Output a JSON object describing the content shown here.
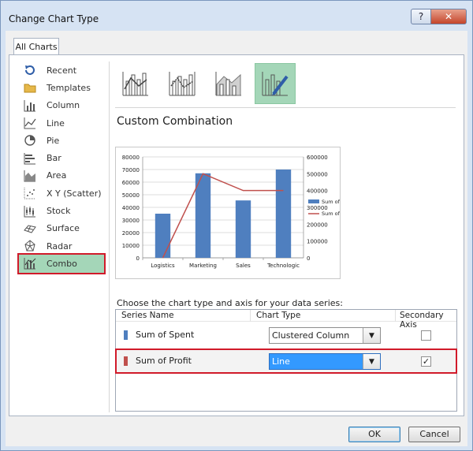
{
  "window": {
    "title": "Change Chart Type",
    "help": "?",
    "close": "✕"
  },
  "tab": "All Charts",
  "categories": [
    {
      "label": "Recent",
      "icon": "recent-icon"
    },
    {
      "label": "Templates",
      "icon": "templates-icon"
    },
    {
      "label": "Column",
      "icon": "column-chart-icon"
    },
    {
      "label": "Line",
      "icon": "line-chart-icon"
    },
    {
      "label": "Pie",
      "icon": "pie-chart-icon"
    },
    {
      "label": "Bar",
      "icon": "bar-chart-icon"
    },
    {
      "label": "Area",
      "icon": "area-chart-icon"
    },
    {
      "label": "X Y (Scatter)",
      "icon": "scatter-chart-icon"
    },
    {
      "label": "Stock",
      "icon": "stock-chart-icon"
    },
    {
      "label": "Surface",
      "icon": "surface-chart-icon"
    },
    {
      "label": "Radar",
      "icon": "radar-chart-icon"
    },
    {
      "label": "Combo",
      "icon": "combo-chart-icon",
      "selected": true
    }
  ],
  "heading": "Custom Combination",
  "prompt": "Choose the chart type and axis for your data series:",
  "grid_headers": {
    "name": "Series Name",
    "type": "Chart Type",
    "axis": "Secondary Axis"
  },
  "series": [
    {
      "name": "Sum of Spent",
      "color": "#4f7fbf",
      "chart_type": "Clustered Column",
      "secondary": false
    },
    {
      "name": "Sum of Profit",
      "color": "#c0504d",
      "chart_type": "Line",
      "secondary": true
    }
  ],
  "buttons": {
    "ok": "OK",
    "cancel": "Cancel"
  },
  "colors": {
    "selection": "#a4d6b8",
    "highlight": "#d11a2a",
    "column": "#4f7fbf",
    "line": "#c0504d"
  },
  "chart_data": {
    "type": "bar",
    "categories": [
      "Logistics",
      "Marketing",
      "Sales",
      "Technologic"
    ],
    "series": [
      {
        "name": "Sum of Spent",
        "type": "bar",
        "axis": "primary",
        "values": [
          35000,
          67000,
          45500,
          70000
        ]
      },
      {
        "name": "Sum of Profit",
        "type": "line",
        "axis": "secondary",
        "values": [
          0,
          500000,
          400000,
          400000
        ]
      }
    ],
    "ylim": [
      0,
      80000
    ],
    "y2lim": [
      0,
      600000
    ],
    "yticks": [
      "0",
      "10000",
      "20000",
      "30000",
      "40000",
      "50000",
      "60000",
      "70000",
      "80000"
    ],
    "y2ticks": [
      "0",
      "100000",
      "200000",
      "300000",
      "400000",
      "500000",
      "600000"
    ],
    "grid": true,
    "legend": "right"
  }
}
